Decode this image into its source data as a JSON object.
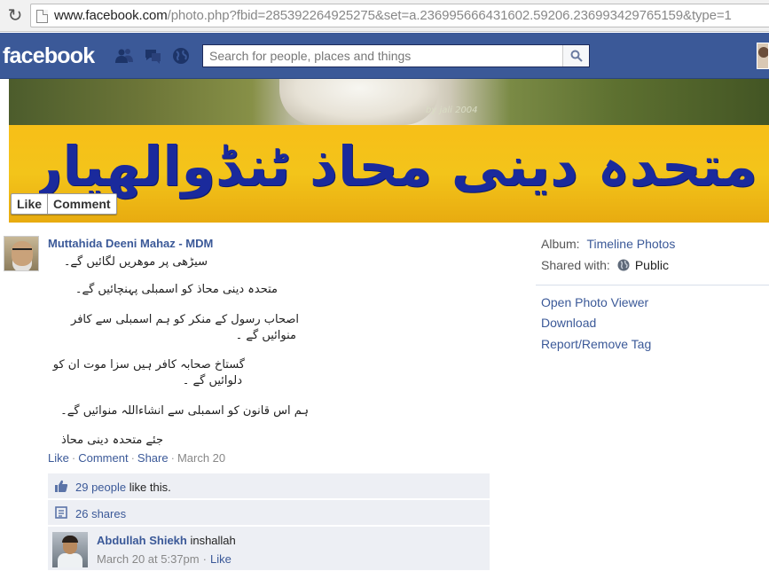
{
  "browser": {
    "url_host": "www.facebook.com",
    "url_path": "/photo.php?fbid=285392264925275&set=a.236995666431602.59206.236993429765159&type=1"
  },
  "fbbar": {
    "logo": "facebook",
    "search_placeholder": "Search for people, places and things"
  },
  "photo": {
    "watermark": "by jali 2004",
    "banner_text": "متحدہ دینی محاذ ٹنڈوالھیار",
    "like_label": "Like",
    "comment_label": "Comment"
  },
  "post": {
    "author": "Muttahida Deeni Mahaz - MDM",
    "lines": [
      "سیڑھی پر موھریں لگائیں گے۔",
      "متحدہ دینی محاذ کو اسمبلی پہنچائیں گے۔",
      "اصحاب رسول کے منکر کو ہم اسمبلی سے کافر",
      "منوائیں گے ۔",
      "گستاخ صحابہ کافر ہیں سزا موت ان کو",
      "دلوائیں گے ۔",
      "ہم اس قانون کو اسمبلی سے انشاءاللہ منوائیں گے۔",
      "جئے متحدہ دینی محاذ"
    ],
    "actions": {
      "like": "Like",
      "comment": "Comment",
      "share": "Share",
      "time": "March 20",
      "sep": "·"
    },
    "likes": {
      "count_link": "29 people",
      "suffix": " like this."
    },
    "shares": "26 shares",
    "comment": {
      "author": "Abdullah Shiekh",
      "text": " inshallah",
      "time": "March 20 at 5:37pm",
      "sep": "·",
      "like": "Like"
    }
  },
  "sidebar": {
    "album_label": "Album:",
    "album_value": "Timeline Photos",
    "shared_label": "Shared with:",
    "shared_value": "Public",
    "links": [
      "Open Photo Viewer",
      "Download",
      "Report/Remove Tag"
    ]
  },
  "colors": {
    "brand": "#3b5998",
    "banner": "#f3c41a",
    "banner_text": "#1a2a9c",
    "ufi_bg": "#edeff4"
  }
}
